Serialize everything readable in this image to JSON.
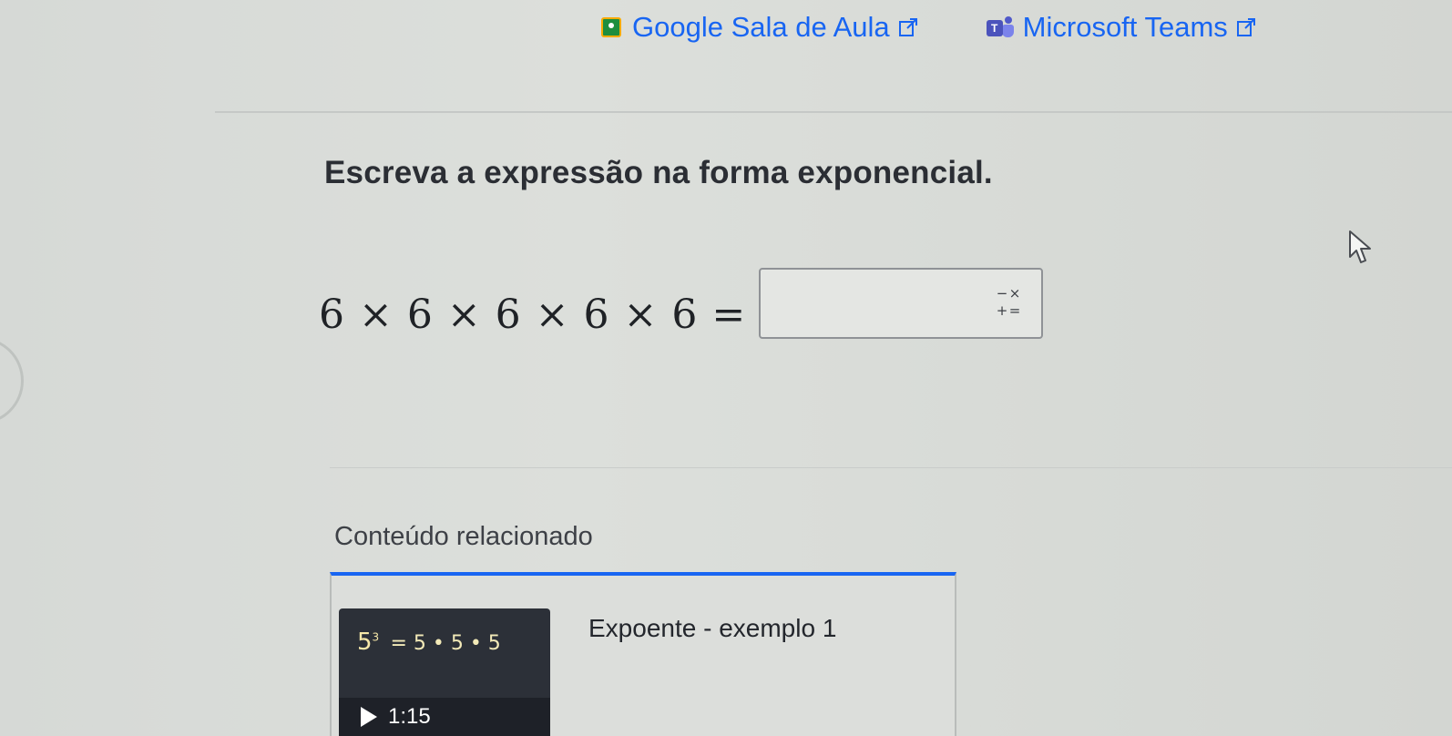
{
  "share": {
    "classroom_label": "Google Sala de Aula",
    "teams_label": "Microsoft Teams",
    "link_color": "#1865f2"
  },
  "question": {
    "prompt": "Escreva a expressão na forma exponencial.",
    "expression": "6 × 6 × 6 × 6 × 6 =",
    "answer_value": "",
    "keypad_glyphs": [
      "−",
      "×",
      "+",
      "="
    ]
  },
  "related": {
    "heading": "Conteúdo relacionado",
    "video": {
      "title": "Expoente - exemplo 1",
      "duration": "1:15",
      "thumb_base": "5",
      "thumb_exponent": "3",
      "thumb_rest": "= 5 • 5 • 5",
      "accent_color": "#1865f2"
    }
  },
  "icons": {
    "classroom": "google-classroom-icon",
    "teams": "microsoft-teams-icon",
    "external": "external-link-icon",
    "keypad": "math-keypad-icon",
    "play": "play-icon",
    "cursor": "mouse-cursor-icon"
  }
}
